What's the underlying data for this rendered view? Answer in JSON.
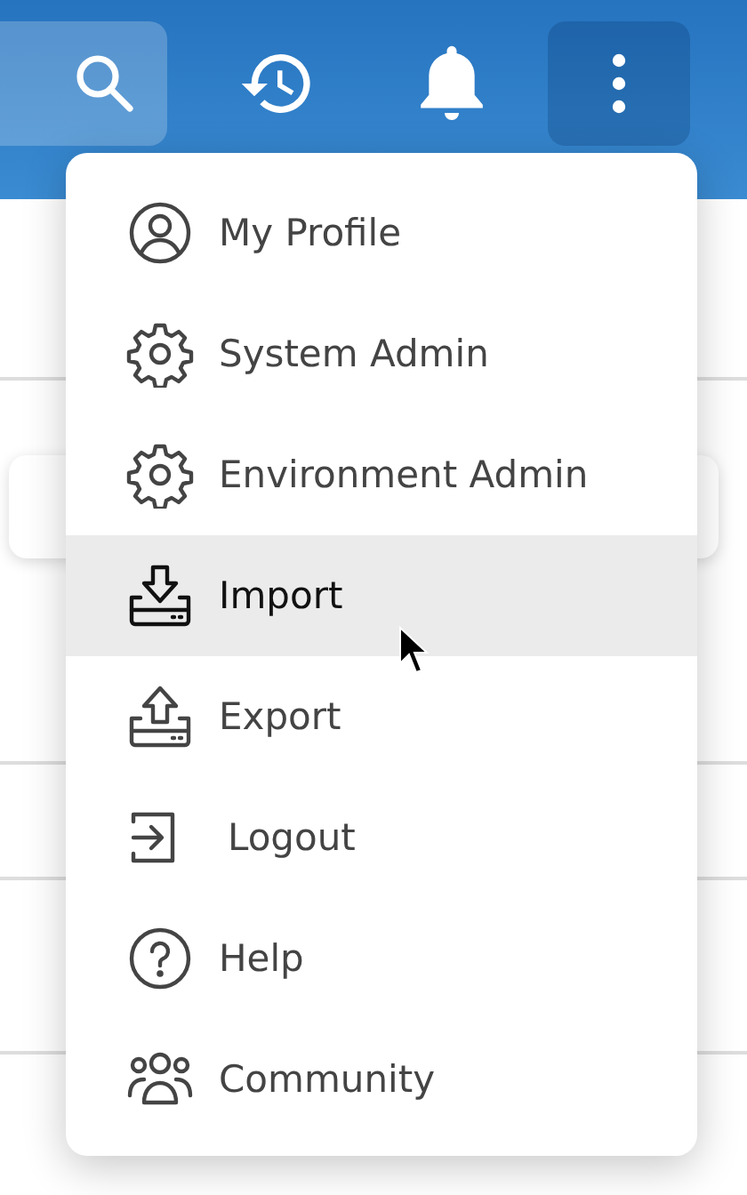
{
  "header": {
    "more_button": {
      "selected": true
    }
  },
  "menu": {
    "items": [
      {
        "label": "My Profile",
        "selected": false
      },
      {
        "label": "System Admin",
        "selected": false
      },
      {
        "label": "Environment Admin",
        "selected": false
      },
      {
        "label": "Import",
        "selected": true
      },
      {
        "label": "Export",
        "selected": false
      },
      {
        "label": "Logout",
        "selected": false
      },
      {
        "label": "Help",
        "selected": false
      },
      {
        "label": "Community",
        "selected": false
      }
    ]
  }
}
